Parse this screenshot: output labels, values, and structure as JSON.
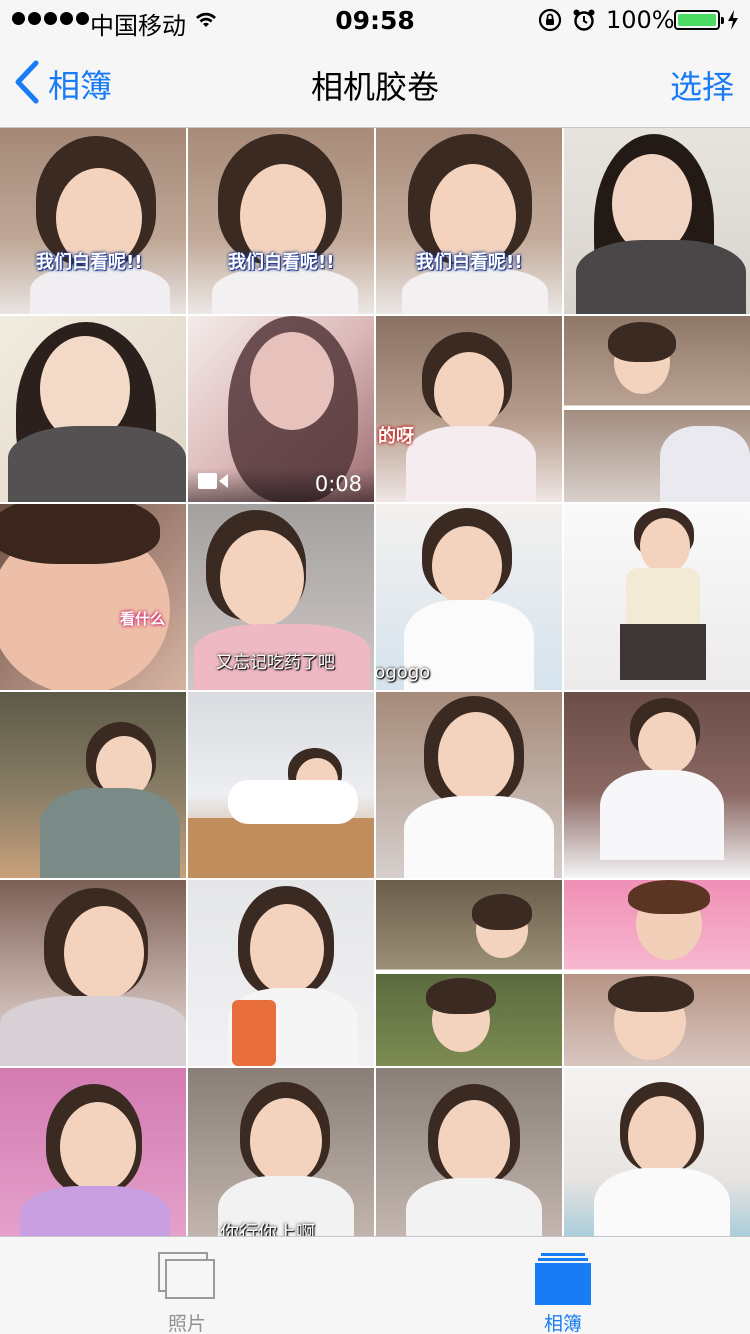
{
  "status_bar": {
    "carrier": "中国移动",
    "time": "09:58",
    "battery": "100%",
    "battery_color": "#4cd964"
  },
  "nav": {
    "back_label": "相簿",
    "title": "相机胶卷",
    "select_label": "选择",
    "accent_color": "#1a7cf5"
  },
  "grid": {
    "captions": {
      "r1": "我们白看呢!!",
      "r2": "的呀",
      "r3_a": "看什么",
      "r3_b": "又忘记吃药了吧",
      "r3_watermark": "@YeHAngogogo",
      "r6": "你行你上啊"
    },
    "video_duration": "0:08"
  },
  "tab_bar": {
    "photos_label": "照片",
    "albums_label": "相簿",
    "selected": "相簿"
  },
  "icons": [
    "chevron-left-icon",
    "wifi-icon",
    "rotation-lock-icon",
    "alarm-icon",
    "charging-icon",
    "video-camera-icon",
    "photos-stack-icon",
    "albums-icon"
  ]
}
